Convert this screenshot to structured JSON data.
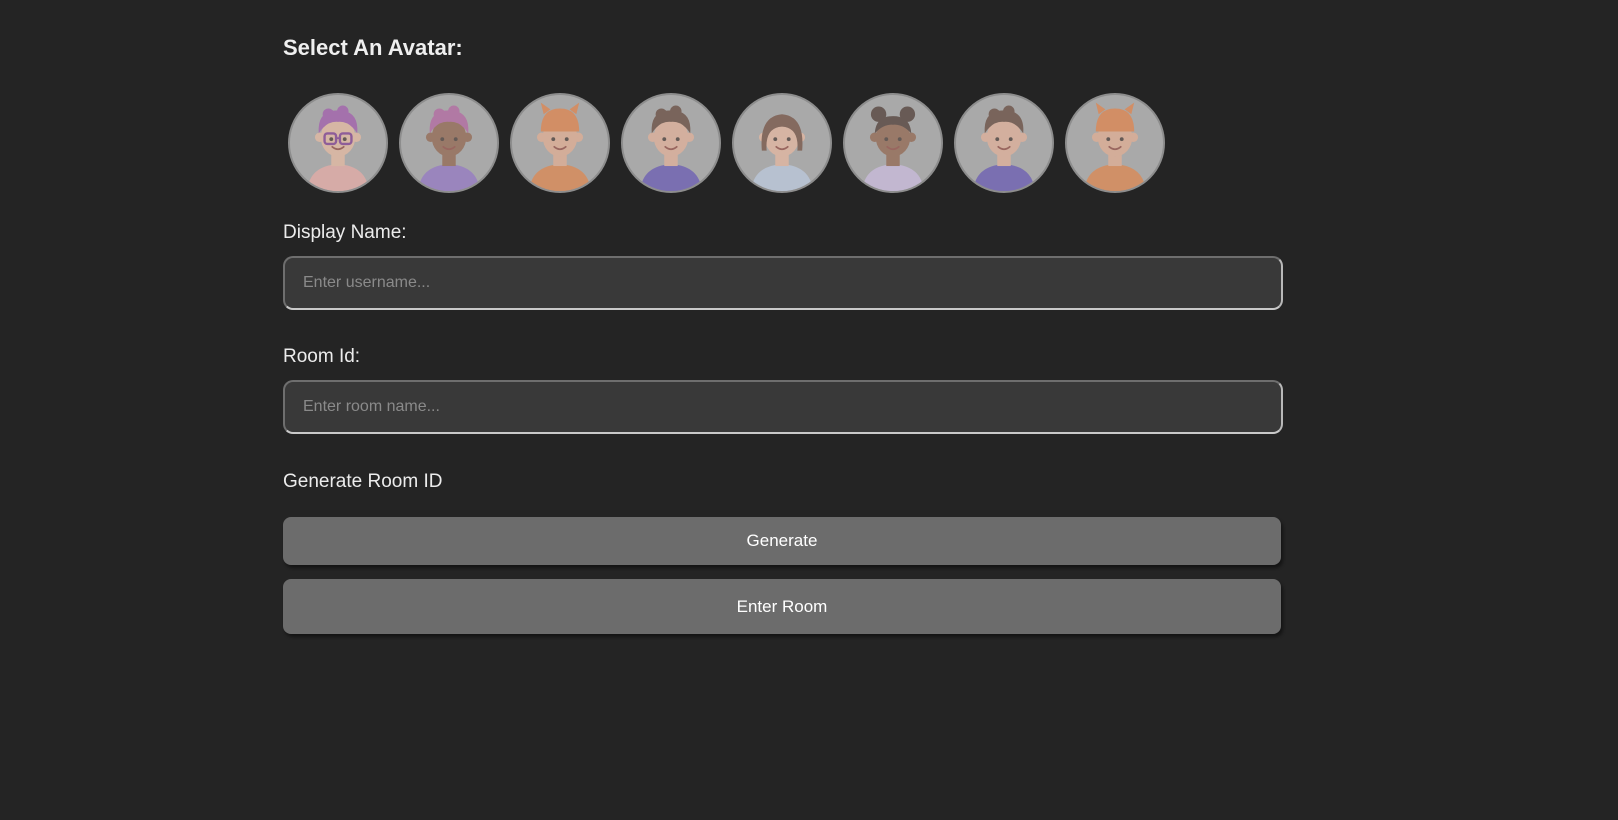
{
  "avatar_section": {
    "heading": "Select An Avatar:",
    "avatars": [
      {
        "icon": "avatar-purple-hair-glasses-icon",
        "hair": "#9b4ea8",
        "skin": "#e9b79b",
        "shirt": "#e9a7a0"
      },
      {
        "icon": "avatar-pink-hair-dark-skin-icon",
        "hair": "#b05a9c",
        "skin": "#8a5a40",
        "shirt": "#8d6cc2"
      },
      {
        "icon": "avatar-orange-beanie-icon",
        "hair": "#e27a3b",
        "skin": "#e3a98b",
        "shirt": "#df7d3e"
      },
      {
        "icon": "avatar-curly-hair-purple-jacket-icon",
        "hair": "#5a3a2c",
        "skin": "#e3ad92",
        "shirt": "#5b4bb0"
      },
      {
        "icon": "avatar-bob-haircut-icon",
        "hair": "#6a4232",
        "skin": "#e9b49a",
        "shirt": "#b9c8df"
      },
      {
        "icon": "avatar-hair-buns-dark-skin-icon",
        "hair": "#3f2a22",
        "skin": "#8a5a40",
        "shirt": "#c9b9df"
      },
      {
        "icon": "avatar-curly-hair-purple-jacket-icon",
        "hair": "#5a3a2c",
        "skin": "#e3ad92",
        "shirt": "#5b4bb0"
      },
      {
        "icon": "avatar-orange-beanie-icon",
        "hair": "#e27a3b",
        "skin": "#e3a98b",
        "shirt": "#df7d3e"
      }
    ]
  },
  "display_name": {
    "label": "Display Name:",
    "value": "",
    "placeholder": "Enter username..."
  },
  "room_id": {
    "label": "Room Id:",
    "value": "",
    "placeholder": "Enter room name..."
  },
  "generate_section": {
    "label": "Generate Room ID",
    "generate_button": "Generate",
    "enter_button": "Enter Room"
  },
  "colors": {
    "background": "#242424",
    "input_background": "#393939",
    "button_background": "#6c6c6c",
    "avatar_background": "#a3a3a3"
  }
}
